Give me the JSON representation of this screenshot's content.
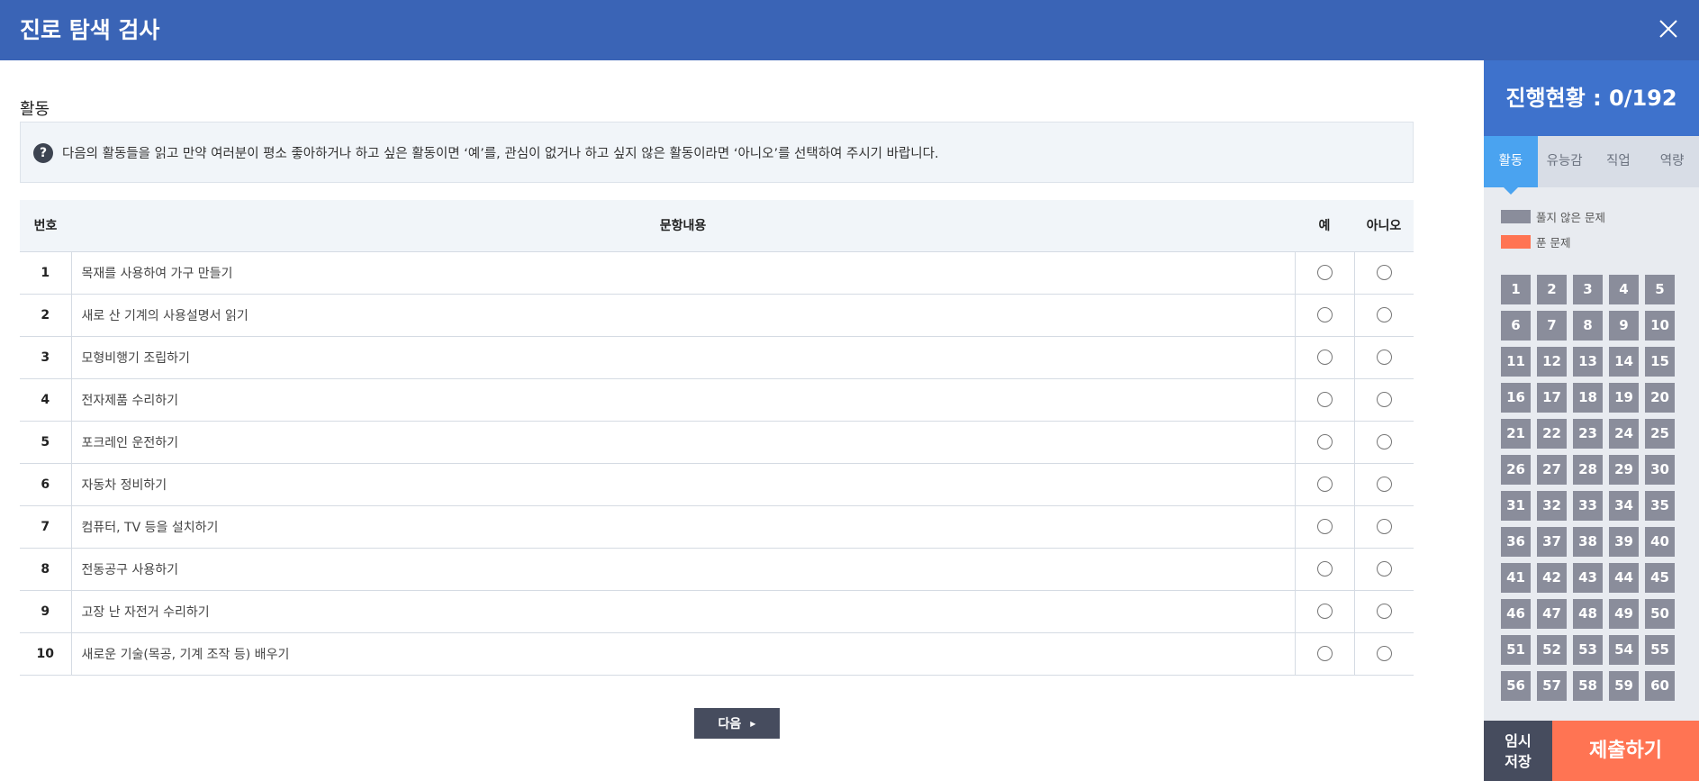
{
  "header": {
    "title": "진로 탐색 검사",
    "close_icon": "close-icon"
  },
  "section": {
    "title": "활동"
  },
  "notice": {
    "icon": "question-icon",
    "icon_glyph": "?",
    "text": "다음의 활동들을 읽고 만약 여러분이 평소 좋아하거나 하고 싶은 활동이면 ‘예’를, 관심이 없거나 하고 싶지 않은 활동이라면 ‘아니오’를 선택하여 주시기 바랍니다."
  },
  "table": {
    "headers": {
      "num": "번호",
      "content": "문항내용",
      "yes": "예",
      "no": "아니오"
    },
    "rows": [
      {
        "num": "1",
        "text": "목재를 사용하여 가구 만들기"
      },
      {
        "num": "2",
        "text": "새로 산 기계의 사용설명서 읽기"
      },
      {
        "num": "3",
        "text": "모형비행기 조립하기"
      },
      {
        "num": "4",
        "text": "전자제품 수리하기"
      },
      {
        "num": "5",
        "text": "포크레인 운전하기"
      },
      {
        "num": "6",
        "text": "자동차 정비하기"
      },
      {
        "num": "7",
        "text": "컴퓨터, TV 등을 설치하기"
      },
      {
        "num": "8",
        "text": "전동공구 사용하기"
      },
      {
        "num": "9",
        "text": "고장 난 자전거 수리하기"
      },
      {
        "num": "10",
        "text": "새로운 기술(목공, 기계 조작 등) 배우기"
      }
    ]
  },
  "next_button": {
    "label": "다음",
    "arrow": "▶"
  },
  "sidebar": {
    "progress": "진행현황 : 0/192",
    "tabs": [
      {
        "label": "활동",
        "active": true
      },
      {
        "label": "유능감",
        "active": false
      },
      {
        "label": "직업",
        "active": false
      },
      {
        "label": "역량",
        "active": false
      }
    ],
    "legend": [
      {
        "label": "풀지 않은 문제",
        "color": "#8a8d9b"
      },
      {
        "label": "푼 문제",
        "color": "#ff7453"
      }
    ],
    "numbers": [
      "1",
      "2",
      "3",
      "4",
      "5",
      "6",
      "7",
      "8",
      "9",
      "10",
      "11",
      "12",
      "13",
      "14",
      "15",
      "16",
      "17",
      "18",
      "19",
      "20",
      "21",
      "22",
      "23",
      "24",
      "25",
      "26",
      "27",
      "28",
      "29",
      "30",
      "31",
      "32",
      "33",
      "34",
      "35",
      "36",
      "37",
      "38",
      "39",
      "40",
      "41",
      "42",
      "43",
      "44",
      "45",
      "46",
      "47",
      "48",
      "49",
      "50",
      "51",
      "52",
      "53",
      "54",
      "55",
      "56",
      "57",
      "58",
      "59",
      "60"
    ],
    "save_line1": "임시",
    "save_line2": "저장",
    "submit": "제출하기"
  },
  "colors": {
    "header": "#3a64b6",
    "progress": "#3e72cc",
    "active_tab": "#4aa3f0",
    "unsolved": "#8a8d9b",
    "solved": "#ff7453"
  }
}
